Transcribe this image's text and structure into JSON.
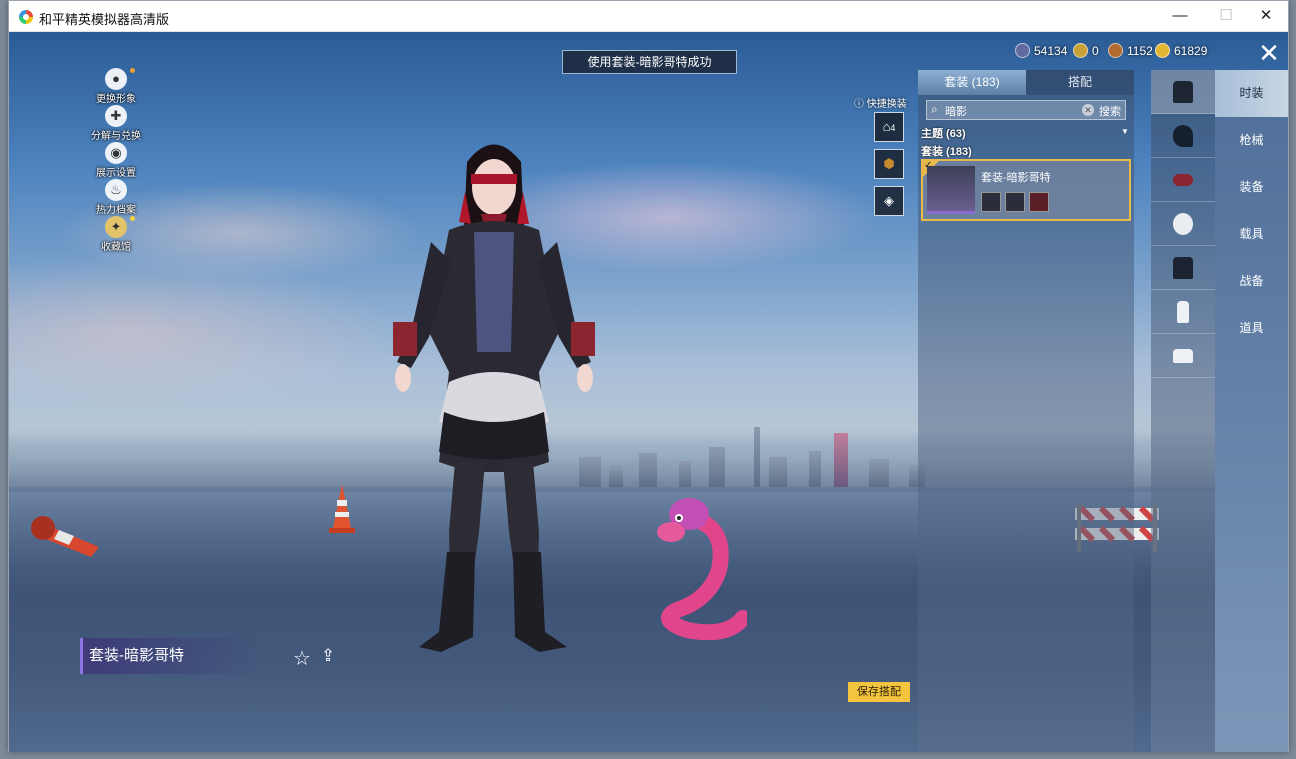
{
  "window": {
    "title": "和平精英模拟器高清版",
    "minimize": "—",
    "maximize": "☐",
    "close": "✕"
  },
  "left_menu": [
    {
      "label": "更换形象",
      "icon": "person-icon"
    },
    {
      "label": "分解与兑换",
      "icon": "puzzle-icon"
    },
    {
      "label": "展示设置",
      "icon": "eye-icon"
    },
    {
      "label": "热力档案",
      "icon": "flame-icon"
    },
    {
      "label": "收藏馆",
      "icon": "collection-icon"
    }
  ],
  "toast": "使用套装-暗影哥特成功",
  "currency": {
    "c1": "54134",
    "c2": "0",
    "c3": "1152",
    "c4": "61829"
  },
  "quick_change": {
    "label": "快捷换装",
    "slot_number": "4"
  },
  "panel": {
    "tab_active": "套装 (183)",
    "tab_other": "搭配",
    "search_value": "暗影",
    "search_button": "搜索",
    "category_theme": "主题 (63)",
    "category_outfit": "套装 (183)",
    "item_name": "套装-暗影哥特"
  },
  "category_bar": [
    "outfit-icon",
    "hair-icon",
    "hat-icon",
    "face-icon",
    "top-icon",
    "pants-icon",
    "shoes-icon"
  ],
  "nav": [
    "时装",
    "枪械",
    "装备",
    "载具",
    "战备",
    "道具"
  ],
  "name_plate": "套装-暗影哥特",
  "save_button": "保存搭配",
  "colors": {
    "accent": "#f3c43d",
    "highlight": "#e6b94a",
    "nav_bg": "#4e6e98"
  }
}
